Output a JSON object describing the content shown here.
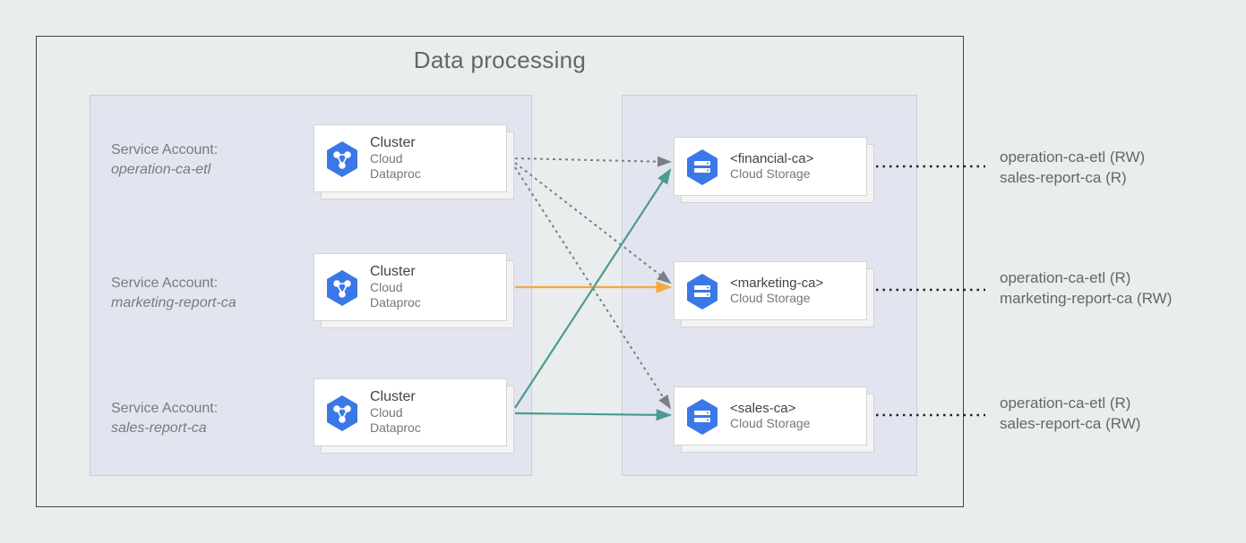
{
  "title": "Data processing",
  "service_accounts": [
    {
      "label": "Service Account:",
      "name": "operation-ca-etl"
    },
    {
      "label": "Service Account:",
      "name": "marketing-report-ca"
    },
    {
      "label": "Service Account:",
      "name": "sales-report-ca"
    }
  ],
  "clusters": [
    {
      "title": "Cluster",
      "sub1": "Cloud",
      "sub2": "Dataproc"
    },
    {
      "title": "Cluster",
      "sub1": "Cloud",
      "sub2": "Dataproc"
    },
    {
      "title": "Cluster",
      "sub1": "Cloud",
      "sub2": "Dataproc"
    }
  ],
  "storages": [
    {
      "title": "<financial-ca>",
      "sub": "Cloud Storage"
    },
    {
      "title": "<marketing-ca>",
      "sub": "Cloud Storage"
    },
    {
      "title": "<sales-ca>",
      "sub": "Cloud Storage"
    }
  ],
  "permissions": [
    {
      "l1": "operation-ca-etl (RW)",
      "l2": "sales-report-ca (R)"
    },
    {
      "l1": "operation-ca-etl (R)",
      "l2": "marketing-report-ca (RW)"
    },
    {
      "l1": "operation-ca-etl (R)",
      "l2": "sales-report-ca (RW)"
    }
  ],
  "colors": {
    "blue": "#3b78e7",
    "arrow_gray": "#7b7e85",
    "arrow_teal": "#4a9b94",
    "arrow_orange": "#f4a93c",
    "black_dash": "#222"
  }
}
